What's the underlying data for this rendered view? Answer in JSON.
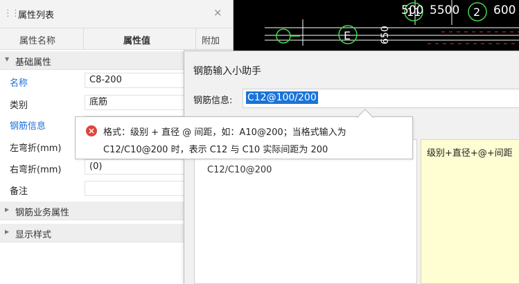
{
  "panel": {
    "title": "属性列表",
    "close_glyph": "×",
    "columns": [
      "属性名称",
      "属性值",
      "附加"
    ],
    "groups": [
      {
        "label": "基础属性",
        "expanded": true
      },
      {
        "label": "钢筋业务属性",
        "expanded": false
      },
      {
        "label": "显示样式",
        "expanded": false
      }
    ],
    "props": [
      {
        "name": "名称",
        "value": "C8-200",
        "highlight": true
      },
      {
        "name": "类别",
        "value": "底筋",
        "highlight": false
      },
      {
        "name": "钢筋信息",
        "value": "",
        "highlight": true
      },
      {
        "name": "左弯折(mm)",
        "value": "",
        "highlight": false
      },
      {
        "name": "右弯折(mm)",
        "value": "(0)",
        "highlight": false
      },
      {
        "name": "备注",
        "value": "",
        "highlight": false
      }
    ]
  },
  "cad": {
    "top_labels": [
      "500",
      "5500",
      "600"
    ],
    "circle_labels": [
      "11",
      "2"
    ],
    "side_labels": [
      "E",
      "650"
    ],
    "colors": {
      "background": "#000000",
      "lines": "#ffffff",
      "green": "#3ddc4a",
      "red": "#d23a3a"
    }
  },
  "dialog": {
    "title": "钢筋输入小助手",
    "rebar_label": "钢筋信息:",
    "rebar_value": "C12@100/200",
    "list_items": [
      "C12/C10@200"
    ],
    "description": "级别+直径+@+间距"
  },
  "tooltip": {
    "icon": "error-icon",
    "line1": "格式：级别 + 直径 @ 间距，如：A10@200；当格式输入为",
    "line2": "C12/C10@200 时，表示 C12 与 C10 实际间距为 200"
  },
  "colors": {
    "accent_blue": "#1e6fd9",
    "selection": "#1a73d9",
    "error": "#e0443c",
    "desc_bg": "#fefed2"
  }
}
